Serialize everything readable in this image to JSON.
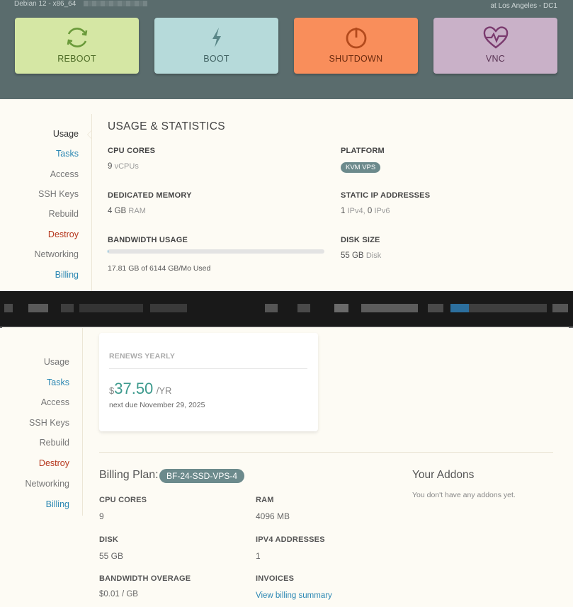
{
  "header": {
    "os_label": "Debian 12 - x86_64",
    "location": "at Los Angeles - DC1",
    "actions": [
      {
        "label": "REBOOT",
        "icon": "refresh-icon"
      },
      {
        "label": "BOOT",
        "icon": "lightning-bolt-icon"
      },
      {
        "label": "SHUTDOWN",
        "icon": "power-icon"
      },
      {
        "label": "VNC",
        "icon": "heart-pulse-icon"
      }
    ]
  },
  "nav": {
    "items": [
      {
        "label": "Usage",
        "color": "#333333"
      },
      {
        "label": "Tasks",
        "color": "#2b87b3"
      },
      {
        "label": "Access",
        "color": "#777777"
      },
      {
        "label": "SSH Keys",
        "color": "#777777"
      },
      {
        "label": "Rebuild",
        "color": "#777777"
      },
      {
        "label": "Destroy",
        "color": "#b5351b"
      },
      {
        "label": "Networking",
        "color": "#777777"
      },
      {
        "label": "Billing",
        "color": "#2b87b3"
      }
    ]
  },
  "usage": {
    "title": "USAGE & STATISTICS",
    "cpu": {
      "label": "CPU CORES",
      "value": "9",
      "unit": "vCPUs"
    },
    "platform": {
      "label": "PLATFORM",
      "value": "KVM VPS"
    },
    "memory": {
      "label": "DEDICATED MEMORY",
      "value": "4 GB",
      "unit": "RAM"
    },
    "ips": {
      "label": "STATIC IP ADDRESSES",
      "v4": "1",
      "v4_unit": "IPv4,",
      "v6": "0",
      "v6_unit": "IPv6"
    },
    "bandwidth": {
      "label": "BANDWIDTH USAGE",
      "text": "17.81 GB of 6144 GB/Mo Used",
      "fraction": 0.0029
    },
    "disk": {
      "label": "DISK SIZE",
      "value": "55 GB",
      "unit": "Disk"
    }
  },
  "billing": {
    "renew_label": "RENEWS YEARLY",
    "currency": "$",
    "price": "37.50",
    "period": "/YR",
    "next_due": "next due November 29, 2025",
    "plan_title": "Billing Plan:",
    "plan_name": "BF-24-SSD-VPS-4",
    "cpu": {
      "label": "CPU CORES",
      "value": "9"
    },
    "ram": {
      "label": "RAM",
      "value": "4096 MB"
    },
    "disk": {
      "label": "DISK",
      "value": "55 GB"
    },
    "ipv4": {
      "label": "IPV4 ADDRESSES",
      "value": "1"
    },
    "overage": {
      "label": "BANDWIDTH OVERAGE",
      "value": "$0.01 / GB"
    },
    "invoices": {
      "label": "INVOICES",
      "link": "View billing summary"
    },
    "addons_title": "Your Addons",
    "addons_text": "You don't have any addons yet."
  }
}
